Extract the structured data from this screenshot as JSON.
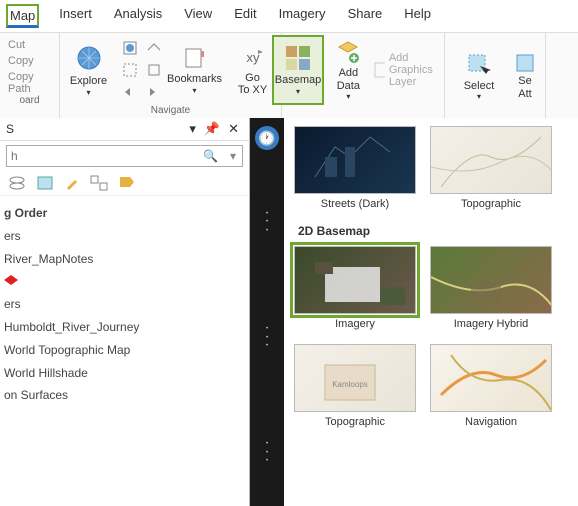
{
  "menu": {
    "map": "Map",
    "insert": "Insert",
    "analysis": "Analysis",
    "view": "View",
    "edit": "Edit",
    "imagery": "Imagery",
    "share": "Share",
    "help": "Help"
  },
  "clipboard": {
    "cut": "Cut",
    "copy": "Copy",
    "copypath": "Copy Path",
    "label": "oard"
  },
  "navigate": {
    "explore": "Explore",
    "bookmarks": "Bookmarks",
    "gotoxy": "Go\nTo XY",
    "group": "Navigate"
  },
  "layer": {
    "basemap": "Basemap",
    "adddata": "Add\nData",
    "graphics": "Add Graphics Layer"
  },
  "selection": {
    "select": "Select",
    "attrs": "Se\nAtt"
  },
  "toc": {
    "title": "S",
    "search_ph": "h",
    "drawing_order": "g Order",
    "items": [
      "ers",
      "River_MapNotes",
      "ers",
      "Humboldt_River_Journey",
      "World Topographic Map",
      "World Hillshade",
      "on Surfaces"
    ]
  },
  "gallery": {
    "row1": [
      "Streets (Dark)",
      "Topographic"
    ],
    "section": "2D Basemap",
    "row2": [
      "Imagery",
      "Imagery Hybrid"
    ],
    "row3": [
      "Topographic",
      "Navigation"
    ]
  }
}
